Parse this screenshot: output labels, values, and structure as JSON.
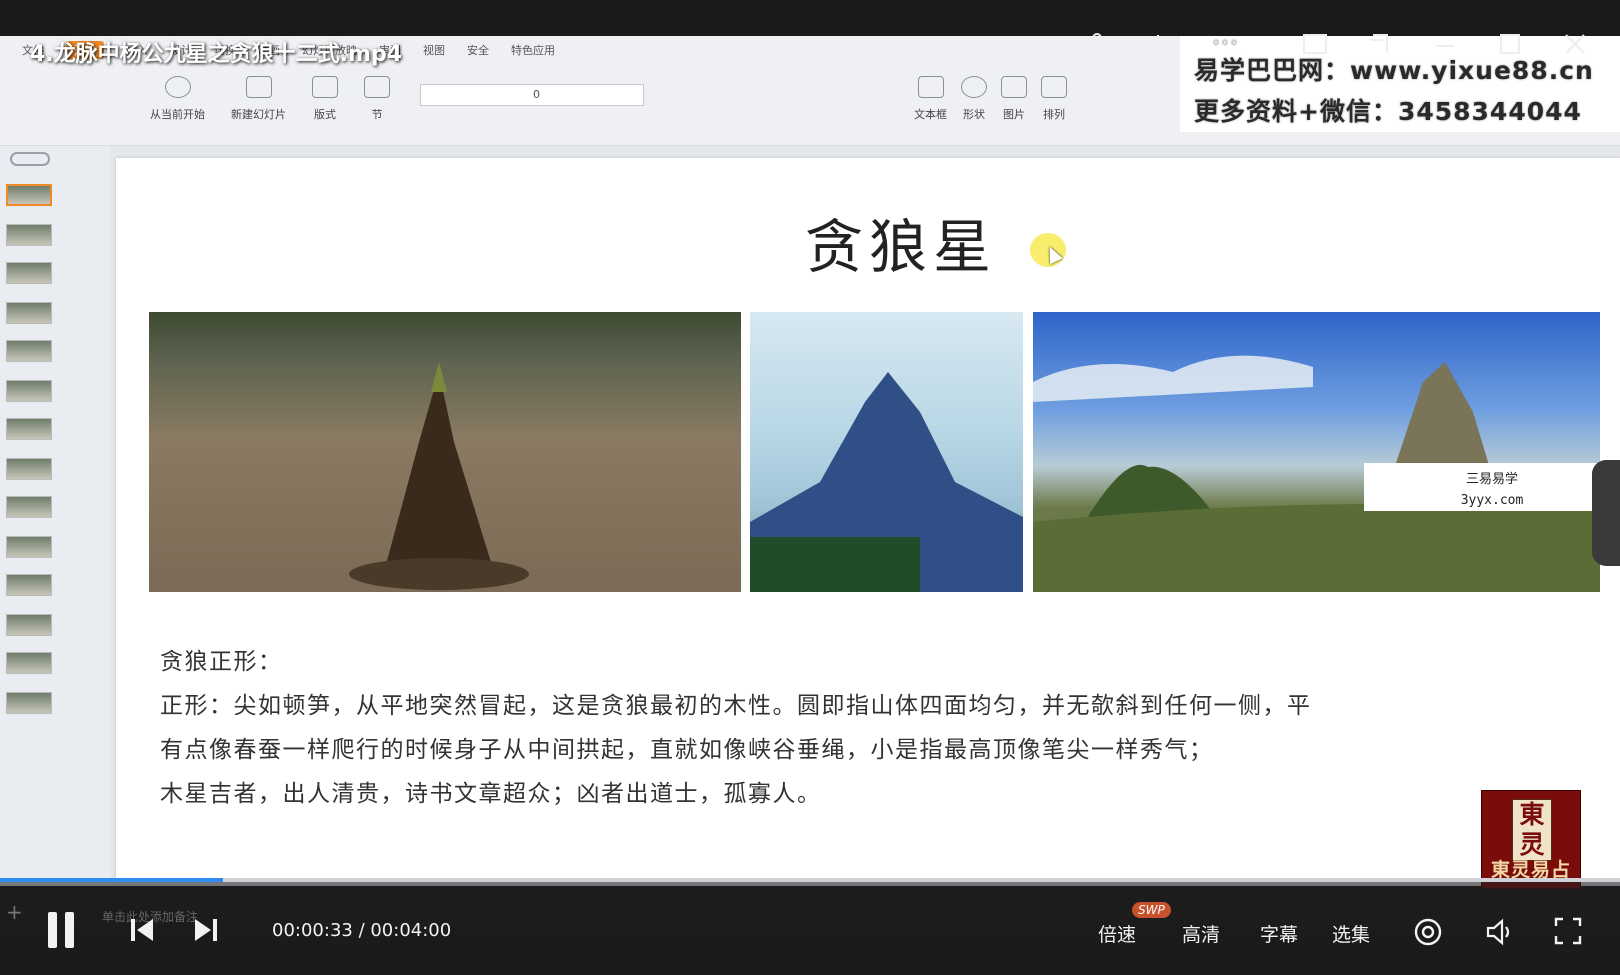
{
  "video": {
    "title": "4.龙脉中杨公九星之贪狼十二式.mp4",
    "current_time": "00:00:33",
    "duration": "00:04:00",
    "time_separator": " / ",
    "progress": 0.1375
  },
  "ribbon": {
    "menu": [
      "文件",
      "开始",
      "插入",
      "设计",
      "切换",
      "动画",
      "幻灯片放映",
      "审阅",
      "视图",
      "安全",
      "特色应用"
    ],
    "active_menu": "开始",
    "tools": [
      "从当前开始",
      "新建幻灯片",
      "版式",
      "节"
    ],
    "font_size_value": "0",
    "right_tools": [
      "文本框",
      "形状",
      "图片",
      "排列"
    ]
  },
  "watermark": {
    "line1": "易学巴巴网：www.yixue88.cn",
    "line2": "更多资料+微信：3458344044"
  },
  "slide": {
    "title": "贪狼星",
    "caption_line1": "三易易学",
    "caption_line2": "3yyx.com",
    "body": [
      "贪狼正形：",
      "正形：尖如顿笋，从平地突然冒起，这是贪狼最初的木性。圆即指山体四面均匀，并无欹斜到任何一侧，平",
      "有点像春蚕一样爬行的时候身子从中间拱起，直就如像峡谷垂绳，小是指最高顶像笔尖一样秀气；",
      "木星吉者，出人清贵，诗书文章超众；凶者出道士，孤寡人。"
    ],
    "add_note": "单击此处添加备注"
  },
  "logo": {
    "seal_top": "東",
    "seal_bottom": "灵",
    "name": "東灵易占"
  },
  "controls": {
    "speed": "倍速",
    "quality": "高清",
    "subtitles": "字幕",
    "episodes": "选集",
    "swp_badge": "SWP"
  },
  "colors": {
    "progress": "#2f8cf0",
    "accent": "#f08a24",
    "quality_text": "#f2f2f2"
  },
  "icons": [
    "share-icon",
    "download-icon",
    "more-icon",
    "pip-icon",
    "minimize-icon",
    "maximize-icon",
    "close-icon",
    "pause-icon",
    "prev-icon",
    "next-icon",
    "settings-icon",
    "volume-icon",
    "fullscreen-icon"
  ]
}
